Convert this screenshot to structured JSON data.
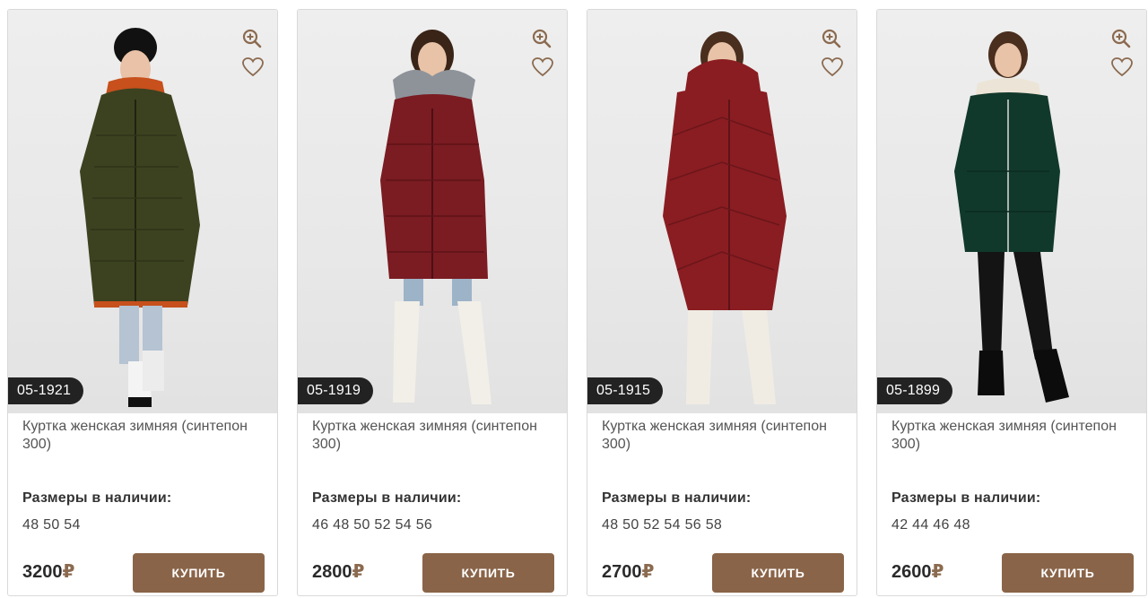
{
  "products": [
    {
      "sku": "05-1921",
      "title": "Куртка женская зимняя (синтепон 300)",
      "sizes_label": "Размеры в наличии:",
      "sizes": "48 50 54",
      "price": "3200",
      "currency": "₽",
      "buy_label": "КУПИТЬ",
      "coat_color": "#3c4220",
      "photo_desc": "khaki-winter-coat"
    },
    {
      "sku": "05-1919",
      "title": "Куртка женская зимняя (синтепон 300)",
      "sizes_label": "Размеры в наличии:",
      "sizes": "46 48 50 52 54 56",
      "price": "2800",
      "currency": "₽",
      "buy_label": "КУПИТЬ",
      "coat_color": "#7a1c22",
      "photo_desc": "burgundy-coat-fur-hood"
    },
    {
      "sku": "05-1915",
      "title": "Куртка женская зимняя (синтепон 300)",
      "sizes_label": "Размеры в наличии:",
      "sizes": "48 50 52 54 56 58",
      "price": "2700",
      "currency": "₽",
      "buy_label": "КУПИТЬ",
      "coat_color": "#8a1d22",
      "photo_desc": "red-long-quilted-coat"
    },
    {
      "sku": "05-1899",
      "title": "Куртка женская зимняя (синтепон 300)",
      "sizes_label": "Размеры в наличии:",
      "sizes": "42 44 46 48",
      "price": "2600",
      "currency": "₽",
      "buy_label": "КУПИТЬ",
      "coat_color": "#11392b",
      "photo_desc": "green-short-coat"
    }
  ],
  "colors": {
    "accent": "#8a6448",
    "badge_bg": "#222222",
    "icon": "#8b6a4f"
  },
  "icons": {
    "zoom": "zoom-in-icon",
    "favorite": "heart-icon"
  }
}
